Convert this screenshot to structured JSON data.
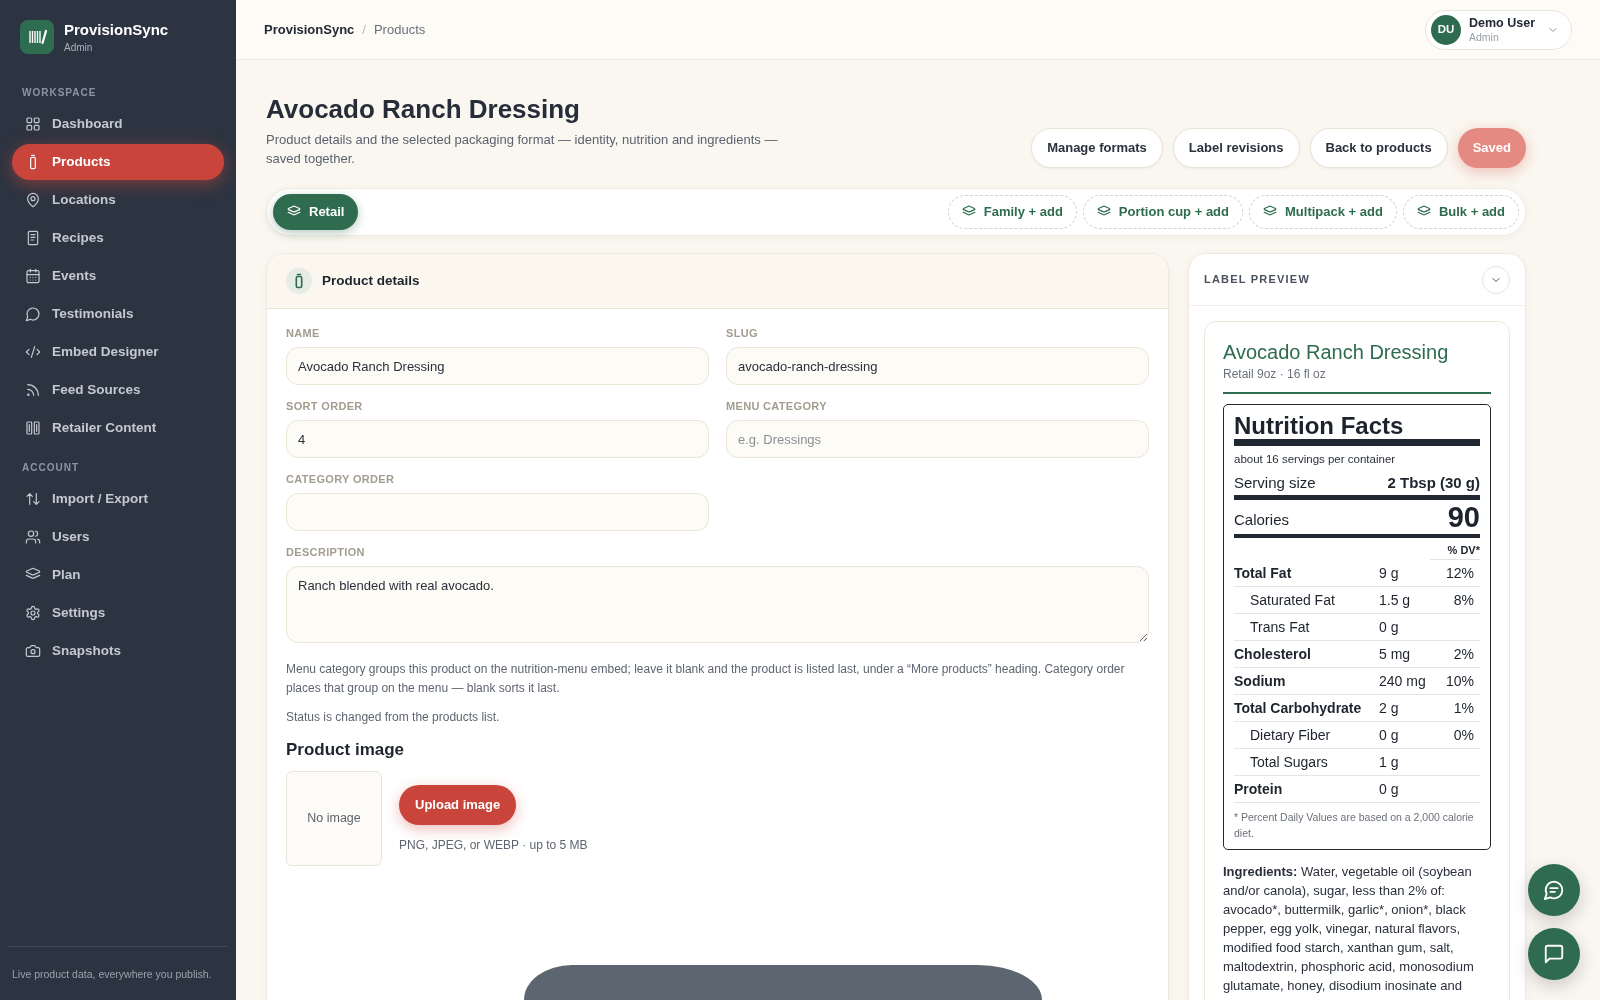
{
  "sidebar": {
    "brand": {
      "name": "ProvisionSync",
      "subtitle": "Admin"
    },
    "sections": [
      {
        "heading": "WORKSPACE",
        "items": [
          {
            "label": "Dashboard",
            "selected": false
          },
          {
            "label": "Products",
            "selected": true
          },
          {
            "label": "Locations",
            "selected": false
          },
          {
            "label": "Recipes",
            "selected": false
          },
          {
            "label": "Events",
            "selected": false
          },
          {
            "label": "Testimonials",
            "selected": false
          },
          {
            "label": "Embed Designer",
            "selected": false
          },
          {
            "label": "Feed Sources",
            "selected": false
          },
          {
            "label": "Retailer Content",
            "selected": false
          }
        ]
      },
      {
        "heading": "ACCOUNT",
        "items": [
          {
            "label": "Import / Export",
            "selected": false
          },
          {
            "label": "Users",
            "selected": false
          },
          {
            "label": "Plan",
            "selected": false
          },
          {
            "label": "Settings",
            "selected": false
          },
          {
            "label": "Snapshots",
            "selected": false
          }
        ]
      }
    ],
    "footer": "Live product data, everywhere you publish."
  },
  "topbar": {
    "breadcrumb": [
      {
        "label": "ProvisionSync",
        "current": false
      },
      {
        "label": "Products",
        "current": true
      }
    ],
    "separator": "/",
    "user": {
      "initials": "DU",
      "name": "Demo User",
      "role": "Admin"
    }
  },
  "page": {
    "title": "Avocado Ranch Dressing",
    "description": "Product details and the selected packaging format — identity, nutrition and ingredients — saved together.",
    "actions": [
      {
        "label": "Manage formats",
        "kind": "secondary",
        "disabled": false
      },
      {
        "label": "Label revisions",
        "kind": "secondary",
        "disabled": false
      },
      {
        "label": "Back to products",
        "kind": "secondary",
        "disabled": false
      },
      {
        "label": "Saved",
        "kind": "primary",
        "disabled": true
      }
    ]
  },
  "formats": [
    {
      "label": "Retail",
      "selected": true
    },
    {
      "label": "Family + add",
      "selected": false
    },
    {
      "label": "Portion cup + add",
      "selected": false
    },
    {
      "label": "Multipack + add",
      "selected": false
    },
    {
      "label": "Bulk + add",
      "selected": false
    }
  ],
  "product_details": {
    "title": "Product details",
    "fields": [
      {
        "label": "NAME",
        "kind": "text",
        "value": "Avocado Ranch Dressing"
      },
      {
        "label": "SLUG",
        "kind": "text",
        "value": "avocado-ranch-dressing"
      },
      {
        "label": "SORT ORDER",
        "kind": "text",
        "value": "4"
      },
      {
        "label": "MENU CATEGORY",
        "kind": "text",
        "placeholder": "e.g. Dressings"
      },
      {
        "label": "CATEGORY ORDER",
        "kind": "text"
      },
      {
        "label": "DESCRIPTION",
        "kind": "textarea",
        "value": "Ranch blended with real avocado."
      }
    ],
    "help": [
      "Menu category groups this product on the nutrition-menu embed; leave it blank and the product is listed last, under a “More products” heading. Category order places that group on the menu — blank sorts it last.",
      "Status is changed from the products list."
    ],
    "image": {
      "heading": "Product image",
      "empty_text": "No image",
      "button": "Upload image",
      "hint": "PNG, JPEG, or WEBP · up to 5 MB"
    }
  },
  "label_preview": {
    "title": "LABEL PREVIEW",
    "product_name": "Avocado Ranch Dressing",
    "format_line": "Retail 9oz · 16 fl oz",
    "nutrition": {
      "title": "Nutrition Facts",
      "servings": "about 16 servings per container",
      "serving_size": {
        "label": "Serving size",
        "value": "2 Tbsp (30 g)"
      },
      "calories": {
        "label": "Calories",
        "value": "90"
      },
      "dv_heading": "% DV*",
      "rows": [
        {
          "name": "Total Fat",
          "amount": "9 g",
          "dv": "12%",
          "kind": "main"
        },
        {
          "name": "Saturated Fat",
          "amount": "1.5 g",
          "dv": "8%",
          "kind": "sub"
        },
        {
          "name": "Trans Fat",
          "amount": "0 g",
          "kind": "sub"
        },
        {
          "name": "Cholesterol",
          "amount": "5 mg",
          "dv": "2%",
          "kind": "main"
        },
        {
          "name": "Sodium",
          "amount": "240 mg",
          "dv": "10%",
          "kind": "main"
        },
        {
          "name": "Total Carbohydrate",
          "amount": "2 g",
          "dv": "1%",
          "kind": "main"
        },
        {
          "name": "Dietary Fiber",
          "amount": "0 g",
          "dv": "0%",
          "kind": "sub"
        },
        {
          "name": "Total Sugars",
          "amount": "1 g",
          "kind": "sub"
        },
        {
          "name": "Protein",
          "amount": "0 g",
          "kind": "main"
        }
      ],
      "footnote": "* Percent Daily Values are based on a 2,000 calorie diet."
    },
    "ingredients": "**Ingredients:** Water, vegetable oil (soybean and/or canola), sugar, less than 2% of: avocado*, buttermilk, garlic*, onion*, black pepper, egg yolk, vinegar, natural flavors, modified food starch, xanthan gum, salt, maltodextrin, phosphoric acid, monosodium glutamate, honey, disodium inosinate and"
  }
}
